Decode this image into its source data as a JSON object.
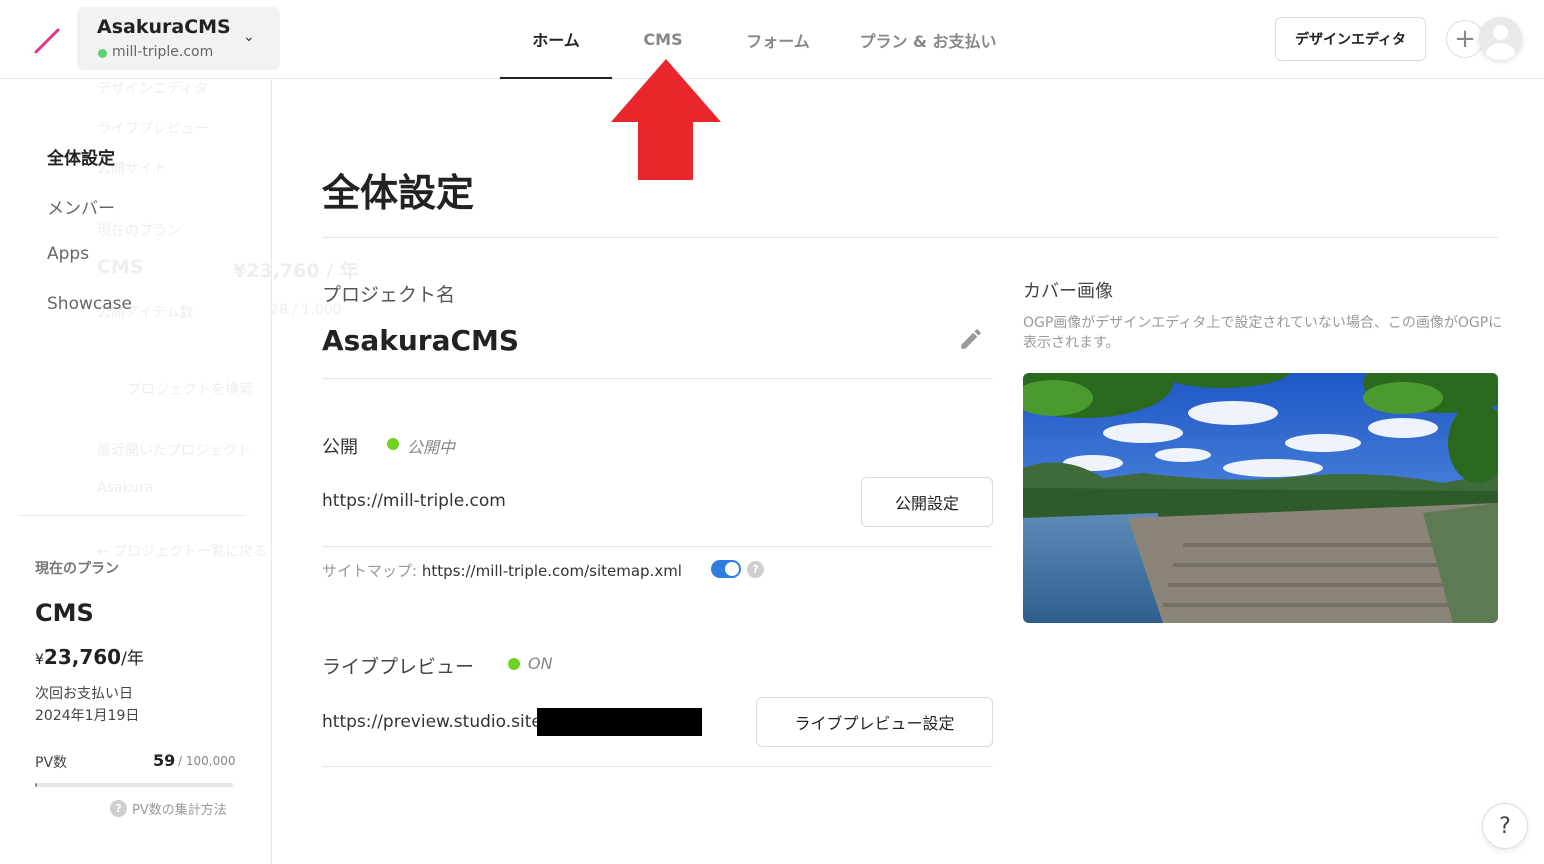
{
  "header": {
    "project_name": "AsakuraCMS",
    "project_domain": "mill-triple.com",
    "tabs": [
      {
        "label": "ホーム",
        "active": true
      },
      {
        "label": "CMS",
        "active": false
      },
      {
        "label": "フォーム",
        "active": false
      },
      {
        "label": "プラン & お支払い",
        "active": false
      }
    ],
    "design_editor_label": "デザインエディタ",
    "plus_label": "+"
  },
  "ghost_menu": {
    "items": [
      "デザインエディタ",
      "ライブプレビュー",
      "公開サイト",
      "現在のプラン",
      "CMS",
      "¥23,760 / 年",
      "公開アイテム数",
      "28 / 1,000",
      "プロジェクトを検索",
      "最近開いたプロジェクト",
      "Asakura",
      "← プロジェクト一覧に戻る"
    ]
  },
  "sidebar": {
    "items": [
      {
        "label": "全体設定",
        "active": true
      },
      {
        "label": "メンバー",
        "active": false
      },
      {
        "label": "Apps",
        "active": false
      },
      {
        "label": "Showcase",
        "active": false
      }
    ],
    "plan": {
      "label": "現在のプラン",
      "name": "CMS",
      "currency": "¥",
      "price": "23,760",
      "per": "/年",
      "next_payment_label": "次回お支払い日",
      "next_payment_date": "2024年1月19日",
      "pv_label": "PV数",
      "pv_count": "59",
      "pv_max": "/ 100,000",
      "pv_fraction": 0.0006,
      "pv_help": "PV数の集計方法"
    }
  },
  "main": {
    "title": "全体設定",
    "project_label": "プロジェクト名",
    "project_value": "AsakuraCMS",
    "publish": {
      "label": "公開",
      "status": "公開中",
      "url": "https://mill-triple.com",
      "settings_button": "公開設定",
      "sitemap_label": "サイトマップ:",
      "sitemap_url": "https://mill-triple.com/sitemap.xml",
      "sitemap_enabled": true
    },
    "live_preview": {
      "label": "ライブプレビュー",
      "status": "ON",
      "url": "https://preview.studio.site",
      "settings_button": "ライブプレビュー設定"
    },
    "cover": {
      "label": "カバー画像",
      "description": "OGP画像がデザインエディタ上で設定されていない場合、この画像がOGPに表示されます。"
    }
  },
  "help_label": "?",
  "colors": {
    "accent_blue": "#2f7de1",
    "status_green": "#6ed321",
    "logo_pink": "#e8318a",
    "arrow_red": "#e8262b"
  }
}
